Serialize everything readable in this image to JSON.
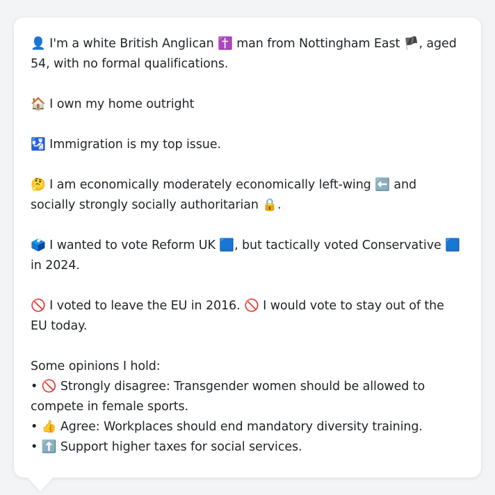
{
  "profile": {
    "identity": {
      "icon": "👤",
      "text_a": " I'm a white British Anglican ",
      "icon2": "✝️",
      "text_b": " man from Nottingham East ",
      "icon3": "🏴",
      "text_c": ", aged 54, with no formal qualifications."
    },
    "home": {
      "icon": "🏠",
      "text": " I own my home outright"
    },
    "issue": {
      "icon": "🛂",
      "text": " Immigration is my top issue."
    },
    "ideology": {
      "icon": "🤔",
      "text_a": " I am economically moderately economically left-wing ",
      "icon2": "⬅️",
      "text_b": " and socially strongly socially authoritarian ",
      "icon3": "🔒",
      "text_c": "."
    },
    "vote": {
      "icon": "🗳️",
      "text_a": " I wanted to vote Reform UK ",
      "icon2": "🟦",
      "text_b": ", but tactically voted Conservative ",
      "icon3": "🟦",
      "text_c": " in 2024."
    },
    "eu": {
      "icon": "🚫",
      "text_a": " I voted to leave the EU in 2016. ",
      "icon2": "🚫",
      "text_b": " I would vote to stay out of the EU today."
    },
    "opinions": {
      "heading": "Some opinions I hold:",
      "items": [
        {
          "bullet": "•",
          "icon": "🚫",
          "text": " Strongly disagree: Transgender women should be allowed to compete in female sports."
        },
        {
          "bullet": "•",
          "icon": "👍",
          "text": " Agree: Workplaces should end mandatory diversity training."
        },
        {
          "bullet": "•",
          "icon": "⬆️",
          "text": " Support higher taxes for social services."
        }
      ]
    }
  }
}
